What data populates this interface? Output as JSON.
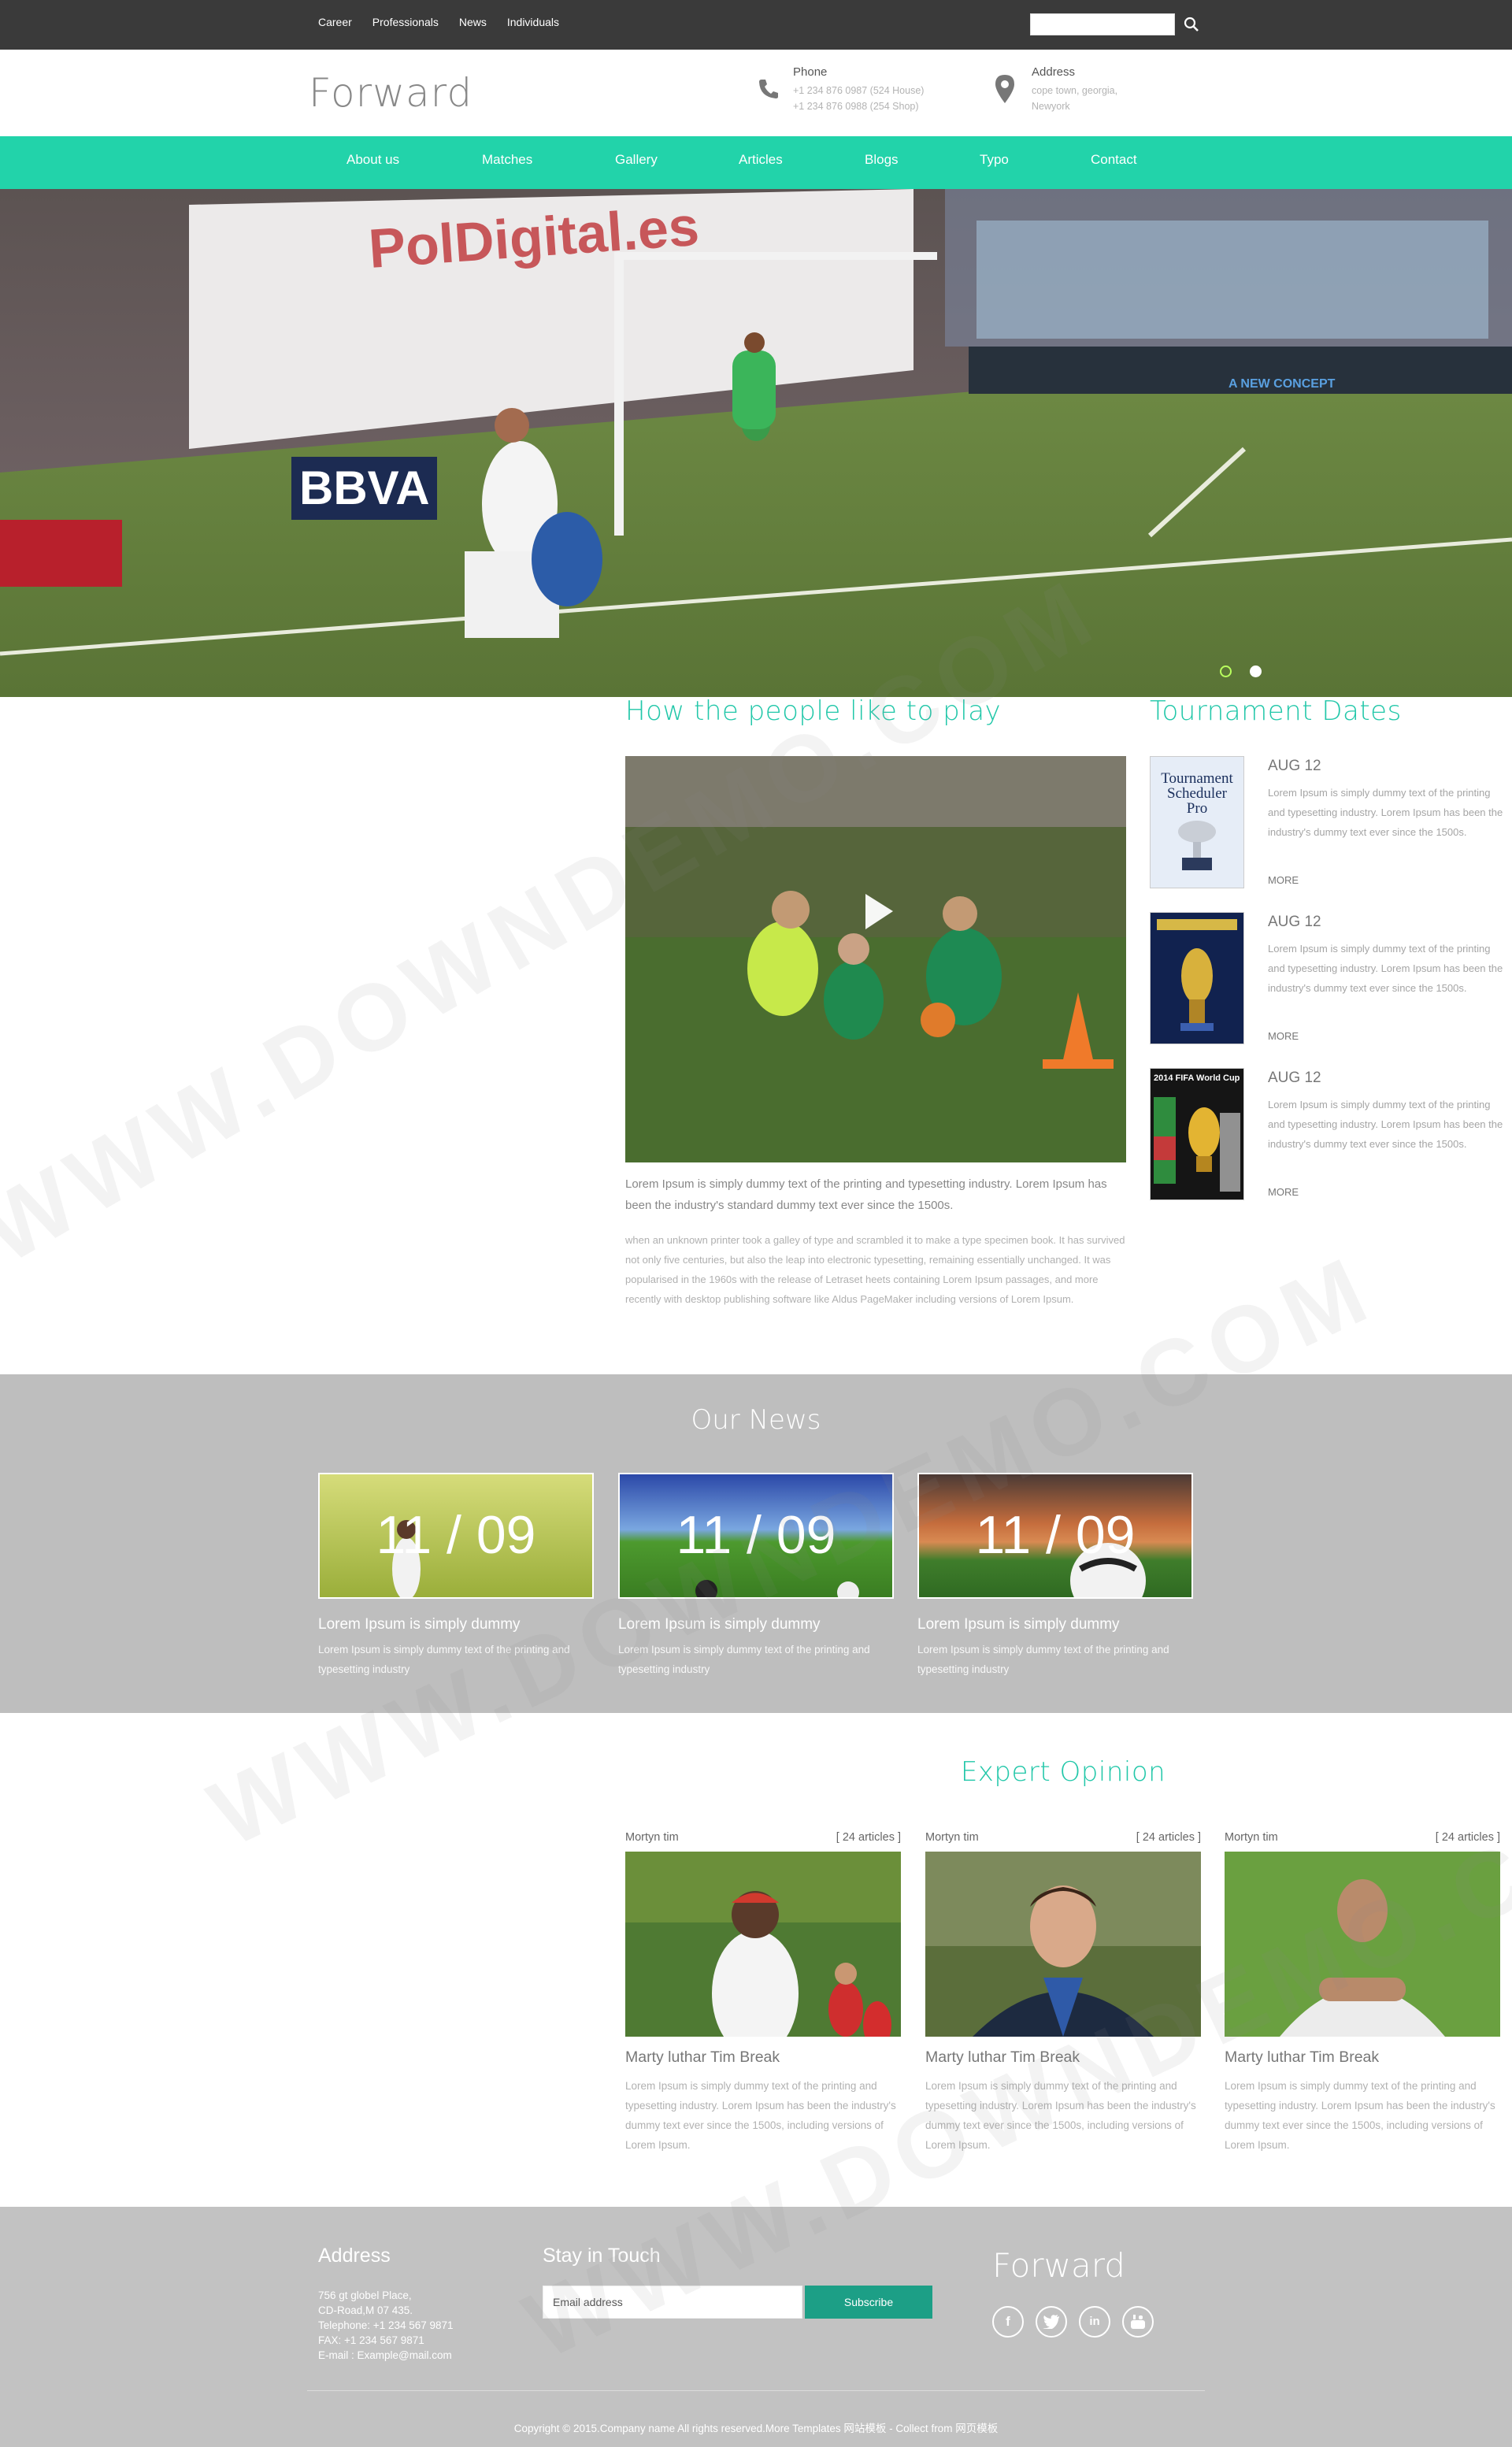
{
  "topbar": {
    "links": [
      "Career",
      "Professionals",
      "News",
      "Individuals"
    ],
    "search_placeholder": ""
  },
  "header": {
    "logo": "Forward",
    "phone": {
      "label": "Phone",
      "line1": "+1 234 876 0987 (524 House)",
      "line2": "+1 234 876 0988 (254 Shop)"
    },
    "address": {
      "label": "Address",
      "line1": "cope town, georgia,",
      "line2": "Newyork"
    }
  },
  "nav": {
    "items": [
      "About us",
      "Matches",
      "Gallery",
      "Articles",
      "Blogs",
      "Typo",
      "Contact"
    ]
  },
  "hero": {
    "slides": 2,
    "active_slide": 2,
    "banner_text": [
      "PolDigital.es",
      "A NEW CONCEPT",
      "BBVA"
    ]
  },
  "play_section": {
    "title": "How the people like to play",
    "lead": "Lorem Ipsum is simply dummy text of the printing and typesetting industry. Lorem Ipsum has been the industry's standard dummy text ever since the 1500s.",
    "body": "when an unknown printer took a galley of type and scrambled it to make a type specimen book. It has survived not only five centuries, but also the leap into electronic typesetting, remaining essentially unchanged. It was popularised in the 1960s with the release of Letraset heets containing Lorem Ipsum passages, and more recently with desktop publishing software like Aldus PageMaker including versions of Lorem Ipsum."
  },
  "tournament": {
    "title": "Tournament Dates",
    "items": [
      {
        "date": "AUG 12",
        "text": "Lorem Ipsum is simply dummy text of the printing and typesetting industry. Lorem Ipsum has been the industry's dummy text ever since the 1500s.",
        "more": "MORE",
        "cover_title": "Tournament Scheduler Pro"
      },
      {
        "date": "AUG 12",
        "text": "Lorem Ipsum is simply dummy text of the printing and typesetting industry. Lorem Ipsum has been the industry's dummy text ever since the 1500s.",
        "more": "MORE",
        "cover_title": ""
      },
      {
        "date": "AUG 12",
        "text": "Lorem Ipsum is simply dummy text of the printing and typesetting industry. Lorem Ipsum has been the industry's dummy text ever since the 1500s.",
        "more": "MORE",
        "cover_title": "2014 FIFA World Cup"
      }
    ]
  },
  "news": {
    "title": "Our News",
    "items": [
      {
        "date": "11 / 09",
        "title": "Lorem Ipsum is simply dummy",
        "text": "Lorem Ipsum is simply dummy text of the printing and typesetting industry"
      },
      {
        "date": "11 / 09",
        "title": "Lorem Ipsum is simply dummy",
        "text": "Lorem Ipsum is simply dummy text of the printing and typesetting industry"
      },
      {
        "date": "11 / 09",
        "title": "Lorem Ipsum is simply dummy",
        "text": "Lorem Ipsum is simply dummy text of the printing and typesetting industry"
      }
    ]
  },
  "experts": {
    "title": "Expert Opinion",
    "items": [
      {
        "author": "Mortyn tim",
        "articles": "[ 24 articles ]",
        "name": "Marty luthar Tim Break",
        "text": "Lorem Ipsum is simply dummy text of the printing and typesetting industry. Lorem Ipsum has been the industry's dummy text ever since the 1500s, including versions of Lorem Ipsum."
      },
      {
        "author": "Mortyn tim",
        "articles": "[ 24 articles ]",
        "name": "Marty luthar Tim Break",
        "text": "Lorem Ipsum is simply dummy text of the printing and typesetting industry. Lorem Ipsum has been the industry's dummy text ever since the 1500s, including versions of Lorem Ipsum."
      },
      {
        "author": "Mortyn tim",
        "articles": "[ 24 articles ]",
        "name": "Marty luthar Tim Break",
        "text": "Lorem Ipsum is simply dummy text of the printing and typesetting industry. Lorem Ipsum has been the industry's dummy text ever since the 1500s, including versions of Lorem Ipsum."
      }
    ]
  },
  "footer": {
    "address_title": "Address",
    "address_lines": [
      "756 gt globel Place,",
      "CD-Road,M 07 435.",
      "Telephone: +1 234 567 9871",
      "FAX: +1 234 567 9871",
      "E-mail : Example@mail.com"
    ],
    "touch_title": "Stay in Touch",
    "email_placeholder": "Email address",
    "subscribe": "Subscribe",
    "logo": "Forward",
    "social": [
      "f",
      "t",
      "in",
      "yt"
    ],
    "copyright": "Copyright © 2015.Company name All rights reserved.More Templates 网站模板 - Collect from 网页模板"
  },
  "watermark": "WWW.DOWNDEMO.COM",
  "colors": {
    "accent": "#22d3aa",
    "accent_dark": "#1c9f86",
    "topbar": "#3a3a3a",
    "band": "#bebebe"
  }
}
